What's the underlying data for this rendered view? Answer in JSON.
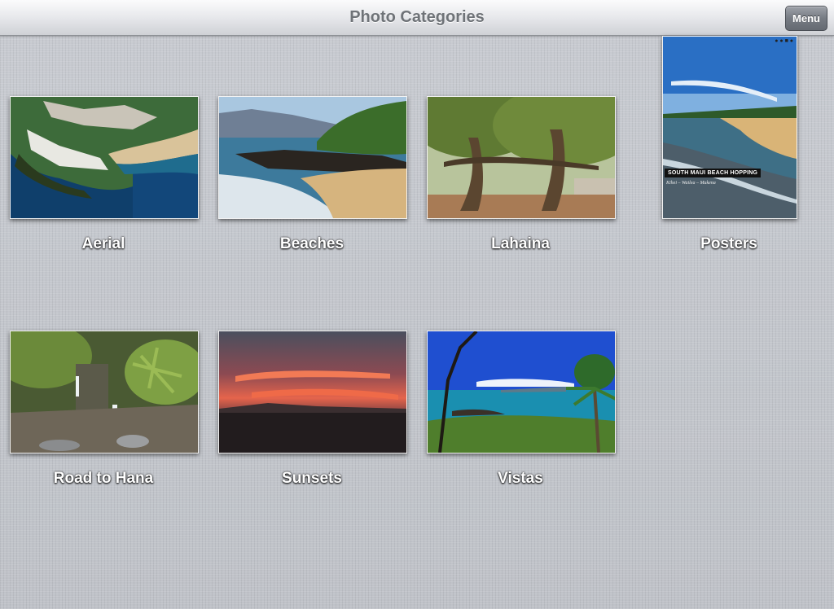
{
  "navbar": {
    "title": "Photo Categories",
    "menu_label": "Menu"
  },
  "categories": [
    {
      "label": "Aerial"
    },
    {
      "label": "Beaches"
    },
    {
      "label": "Lahaina"
    },
    {
      "label": "Posters",
      "poster_title": "SOUTH MAUI BEACH HOPPING",
      "poster_subtitle": "Kihei – Wailea – Makena"
    },
    {
      "label": "Road to Hana"
    },
    {
      "label": "Sunsets"
    },
    {
      "label": "Vistas"
    }
  ],
  "colors": {
    "navbar_title": "#6f7378",
    "background": "#c3c6cc"
  }
}
